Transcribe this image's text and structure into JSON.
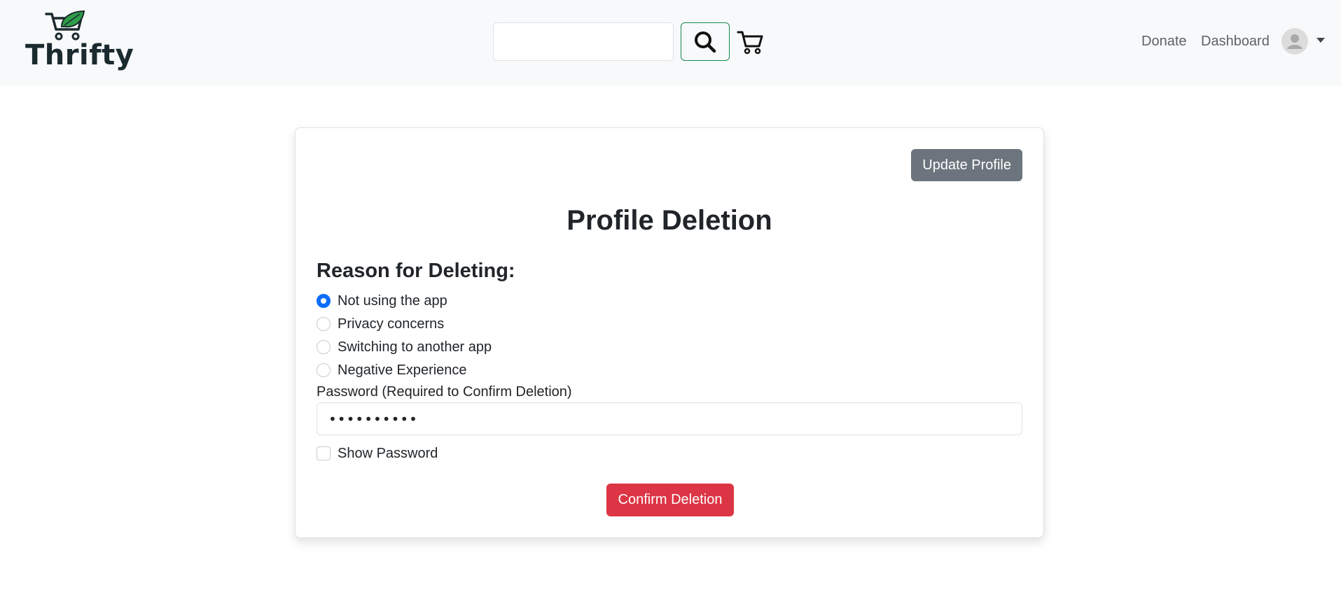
{
  "navbar": {
    "brand_name": "Thrifty",
    "search_placeholder": "",
    "links": [
      "Donate",
      "Dashboard"
    ]
  },
  "card": {
    "update_button": "Update Profile",
    "title": "Profile Deletion",
    "reason_heading": "Reason for Deleting:",
    "reasons": [
      {
        "label": "Not using the app",
        "checked": true
      },
      {
        "label": "Privacy concerns",
        "checked": false
      },
      {
        "label": "Switching to another app",
        "checked": false
      },
      {
        "label": "Negative Experience",
        "checked": false
      }
    ],
    "password_label": "Password (Required to Confirm Deletion)",
    "password_value": "••••••••••",
    "show_password_label": "Show Password",
    "show_password_checked": false,
    "confirm_button": "Confirm Deletion"
  },
  "colors": {
    "navbar_bg": "#f8f9fa",
    "search_border": "#198754",
    "primary": "#0d6efd",
    "secondary": "#6c757d",
    "danger": "#dc3545",
    "leaf": "#2e9e48"
  },
  "icons": {
    "brand": "cart-leaf-icon",
    "search": "search-icon",
    "cart": "cart-icon",
    "avatar": "user-avatar-icon",
    "menu": "caret-down-icon"
  }
}
